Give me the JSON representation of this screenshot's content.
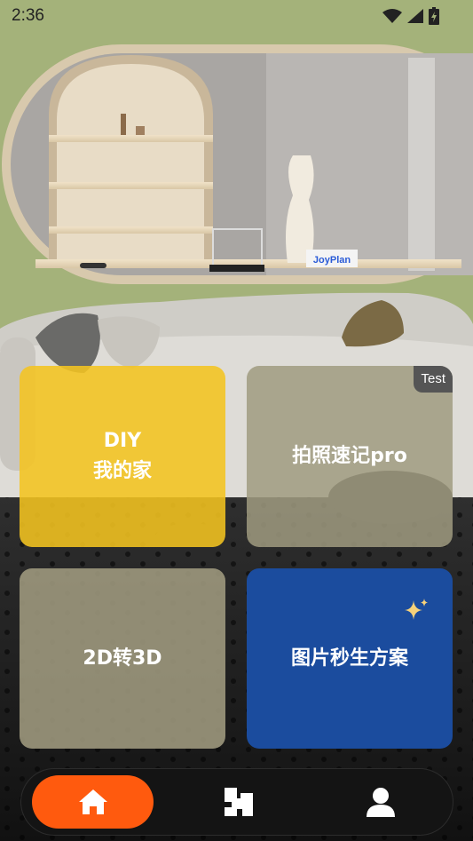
{
  "status_bar": {
    "time": "2:36"
  },
  "cards": {
    "diy": {
      "label": "DIY\n我的家"
    },
    "photo": {
      "label": "拍照速记pro",
      "badge": "Test"
    },
    "convert": {
      "label": "2D转3D"
    },
    "instant": {
      "label": "图片秒生方案"
    }
  },
  "scene": {
    "brand_sign": "JoyPlan"
  },
  "nav": {
    "items": [
      {
        "icon": "home-icon",
        "active": true
      },
      {
        "icon": "floorplan-icon",
        "active": false
      },
      {
        "icon": "profile-icon",
        "active": false
      }
    ],
    "active_color": "#ff5a0e"
  },
  "colors": {
    "diy_card": "#f4c420",
    "instant_card": "#1b4c9e",
    "accent": "#ff5a0e"
  }
}
